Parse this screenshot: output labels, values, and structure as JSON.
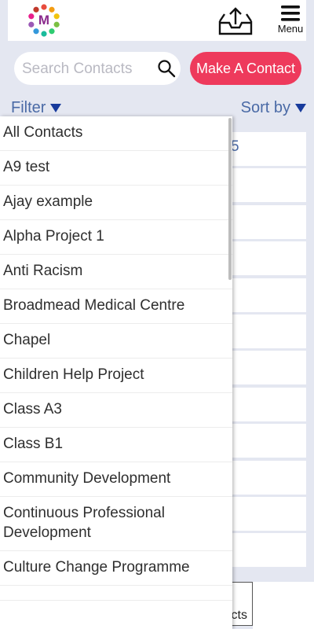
{
  "header": {
    "logo_letter": "M",
    "menu_label": "Menu",
    "logo_dot_colors": [
      "#e84c3d",
      "#f39c12",
      "#f1c40f",
      "#7bc043",
      "#2ecc71",
      "#1abc9c",
      "#3498db",
      "#9b59b6",
      "#e91e8c",
      "#c0392b"
    ]
  },
  "search": {
    "placeholder": "Search Contacts"
  },
  "actions": {
    "make_contact_label": "Make A Contact"
  },
  "toolbar": {
    "filter_label": "Filter",
    "sort_label": "Sort by"
  },
  "background": {
    "partial_row_text": "5",
    "bottom_box_text": "cts"
  },
  "filter_dropdown": {
    "items": [
      "All Contacts",
      "A9 test",
      "Ajay example",
      "Alpha Project 1",
      "Anti Racism",
      "Broadmead Medical Centre",
      "Chapel",
      "Children Help Project",
      "Class A3",
      "Class B1",
      "Community Development",
      "Continuous Professional Development",
      "Culture Change Programme"
    ]
  },
  "colors": {
    "accent": "#ee3a5c",
    "link": "#4a6aa6",
    "arrow": "#173a9c",
    "page_bg": "#e4e7f1"
  }
}
